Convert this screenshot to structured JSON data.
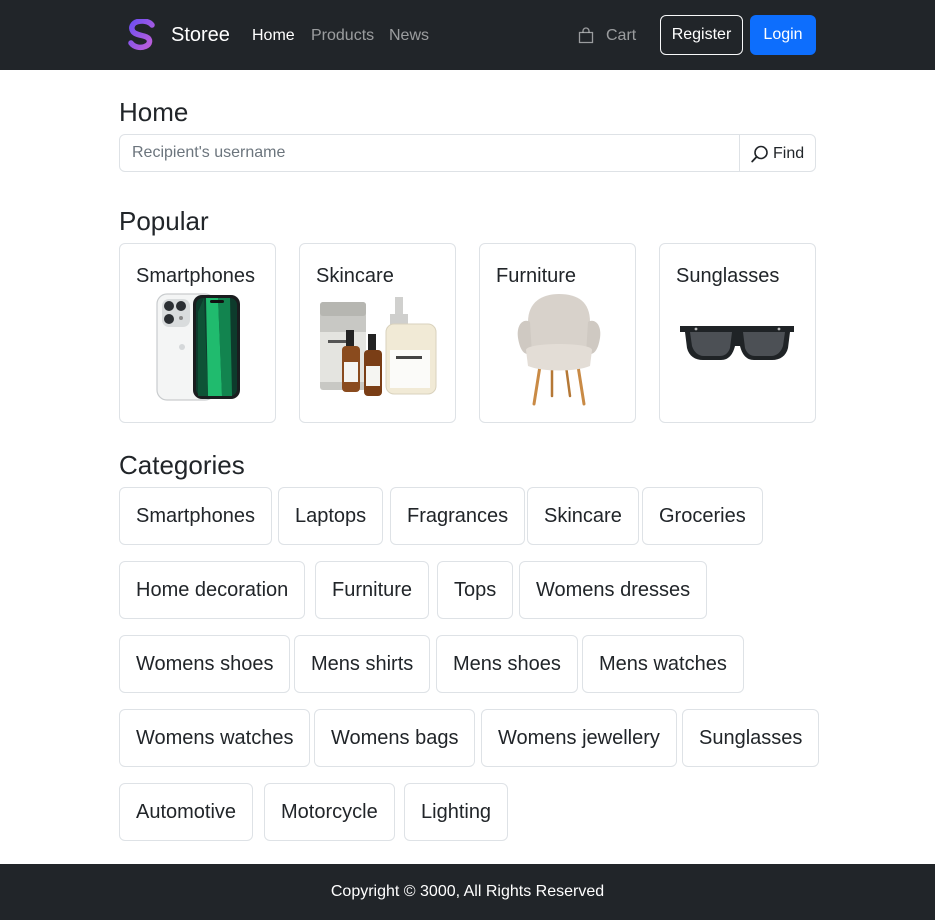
{
  "navbar": {
    "brand": "Storee",
    "brand_logo_icon": "s-logo-icon",
    "brand_gradient": [
      "#7b4ff0",
      "#c061d6"
    ],
    "links": [
      {
        "label": "Home",
        "active": true
      },
      {
        "label": "Products",
        "active": false
      },
      {
        "label": "News",
        "active": false
      }
    ],
    "cart_label": "Cart",
    "cart_icon": "shopping-bag-icon",
    "register_label": "Register",
    "login_label": "Login",
    "accent_color": "#0d6efd",
    "background_color": "#212529"
  },
  "page": {
    "title": "Home"
  },
  "search": {
    "placeholder": "Recipient's username",
    "value": "",
    "button_label": "Find",
    "button_icon": "search-icon"
  },
  "popular": {
    "heading": "Popular",
    "items": [
      {
        "title": "Smartphones",
        "image_icon": "smartphone-image"
      },
      {
        "title": "Skincare",
        "image_icon": "skincare-bottles-image"
      },
      {
        "title": "Furniture",
        "image_icon": "armchair-image"
      },
      {
        "title": "Sunglasses",
        "image_icon": "sunglasses-image"
      }
    ]
  },
  "categories": {
    "heading": "Categories",
    "items": [
      "Smartphones",
      "Laptops",
      "Fragrances",
      "Skincare",
      "Groceries",
      "Home decoration",
      "Furniture",
      "Tops",
      "Womens dresses",
      "Womens shoes",
      "Mens shirts",
      "Mens shoes",
      "Mens watches",
      "Womens watches",
      "Womens bags",
      "Womens jewellery",
      "Sunglasses",
      "Automotive",
      "Motorcycle",
      "Lighting"
    ]
  },
  "footer": {
    "text": "Copyright © 3000, All Rights Reserved"
  }
}
